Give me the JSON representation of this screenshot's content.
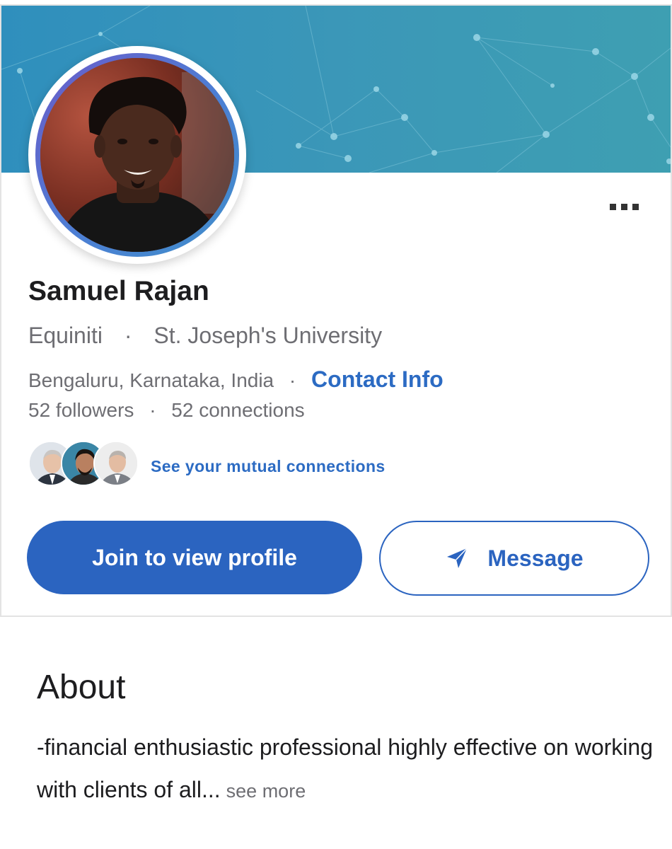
{
  "profile": {
    "name": "Samuel Rajan",
    "company": "Equiniti",
    "school": "St. Joseph's University",
    "location": "Bengaluru, Karnataka, India",
    "contact_info_label": "Contact Info",
    "followers": "52 followers",
    "connections": "52 connections",
    "separator": "·"
  },
  "mutual": {
    "link_label": "See your mutual connections"
  },
  "actions": {
    "join_label": "Join to view profile",
    "message_label": "Message"
  },
  "about": {
    "title": "About",
    "text": "-financial enthusiastic professional highly effective on working with clients of all...",
    "see_more_label": "see more"
  },
  "icons": {
    "more": "more-horizontal-icon",
    "send": "send-icon"
  },
  "colors": {
    "accent": "#2b64c0",
    "banner": "#3b97b8",
    "muted_text": "#6e6e73"
  }
}
